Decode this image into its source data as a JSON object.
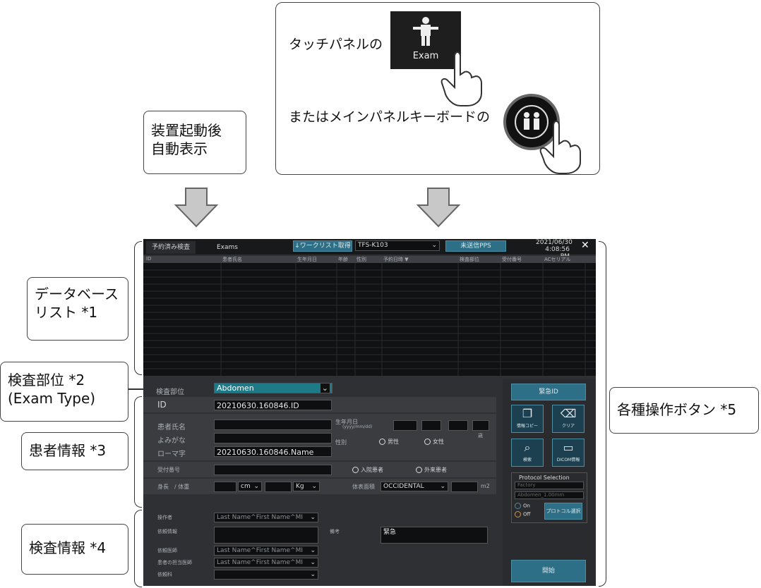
{
  "top_panel": {
    "line1": "タッチパネルの",
    "exam_label": "Exam",
    "line2": "またはメインパネルキーボードの"
  },
  "callouts": {
    "auto_display": [
      "装置起動後",
      "自動表示"
    ],
    "database_list": [
      "データベース",
      "リスト *1"
    ],
    "exam_type": [
      "検査部位 *2",
      "(Exam Type)"
    ],
    "patient_info": "患者情報 *3",
    "exam_info": "検査情報 *4",
    "operation_buttons": "各種操作ボタン *5"
  },
  "screen": {
    "tabs": [
      "予約済み検査",
      "Exams"
    ],
    "worklist_btn": "ワークリスト取得",
    "station_select": "TFS-K103",
    "pps_btn": "未送信PPS",
    "date": "2021/06/30",
    "time": "4:08:56 PM",
    "close": "✕",
    "columns": [
      "ID",
      "患者氏名",
      "生年月日",
      "年齢",
      "性別",
      "予約日時 ▼",
      "検査部位",
      "受付番号",
      "ACセリアル"
    ],
    "exam_type_label": "検査部位",
    "exam_type_value": "Abdomen",
    "id_label": "ID",
    "id_value": "20210630.160846.ID",
    "name_label": "患者氏名",
    "kana_label": "よみがな",
    "roman_label": "ローマ字",
    "roman_value": "20210630.160846.Name",
    "dob_label": "生年月日",
    "dob_format": "(yyyy/mm/dd)",
    "age_unit": "歳",
    "sex_label": "性別",
    "male": "男性",
    "female": "女性",
    "reception_label": "受付番号",
    "inpatient": "入院患者",
    "outpatient": "外来患者",
    "height_label": "身長　/ 体重",
    "cm": "cm",
    "kg": "Kg",
    "bsa_label": "体表面積",
    "bsa_formula": "OCCIDENTAL",
    "m2": "m2",
    "operator_label": "操作者",
    "name_placeholder": "Last Name^First Name^MI",
    "request_label": "依頼情報",
    "remarks_label": "備考",
    "remarks_value": "緊急",
    "requesting_physician_label": "依頼医師",
    "attending_physician_label": "患者の担当医師",
    "requesting_dept_label": "依頼科",
    "emergency_id_btn": "緊急ID",
    "icon_buttons": [
      {
        "icon": "documents-icon",
        "label": "情報コピー"
      },
      {
        "icon": "eraser-icon",
        "label": "クリア"
      },
      {
        "icon": "search-icon",
        "label": "検索"
      },
      {
        "icon": "monitor-icon",
        "label": "DICOM情報"
      }
    ],
    "protocol_title": "Protocol Selection",
    "protocol_field1": "Factory",
    "protocol_field2": "Abdomen_1.00mm",
    "on_label": "On",
    "off_label": "Off",
    "protocol_btn": "プロトコル選択",
    "start_btn": "開始"
  }
}
